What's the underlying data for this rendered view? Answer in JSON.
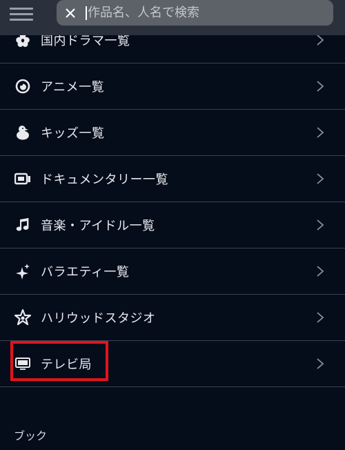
{
  "search": {
    "placeholder": "作品名、人名で検索",
    "value": ""
  },
  "menu": {
    "items": [
      {
        "label": "国内ドラマ一覧",
        "icon": "flower-icon"
      },
      {
        "label": "アニメ一覧",
        "icon": "anime-eye-icon"
      },
      {
        "label": "キッズ一覧",
        "icon": "chick-icon"
      },
      {
        "label": "ドキュメンタリー一覧",
        "icon": "camera-icon"
      },
      {
        "label": "音楽・アイドル一覧",
        "icon": "music-note-icon"
      },
      {
        "label": "バラエティ一覧",
        "icon": "sparkle-icon"
      },
      {
        "label": "ハリウッドスタジオ",
        "icon": "star-outline-icon"
      },
      {
        "label": "テレビ局",
        "icon": "tv-icon"
      }
    ]
  },
  "section": {
    "book_title": "ブック"
  },
  "colors": {
    "background": "#050c1a",
    "header": "#2b313c",
    "search_box": "#5d6168",
    "divider": "#3a4150",
    "highlight": "#e3141b",
    "text": "#e8eaee"
  }
}
